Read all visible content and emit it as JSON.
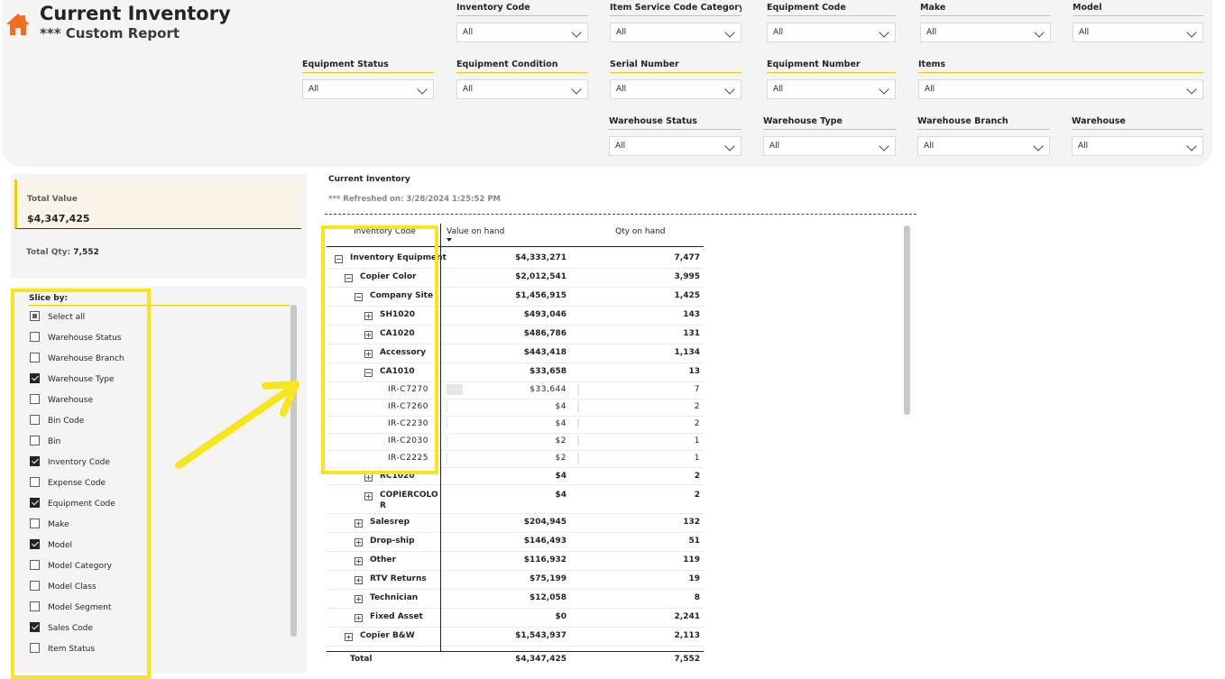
{
  "header": {
    "title": "Current Inventory",
    "subtitle": "*** Custom Report"
  },
  "filters": [
    {
      "label": "Inventory Code",
      "value": "All"
    },
    {
      "label": "Item Service Code Category",
      "value": "All"
    },
    {
      "label": "Equipment Code",
      "value": "All"
    },
    {
      "label": "Make",
      "value": "All"
    },
    {
      "label": "Model",
      "value": "All"
    },
    {
      "label": "Equipment Status",
      "value": "All"
    },
    {
      "label": "Equipment Condition",
      "value": "All"
    },
    {
      "label": "Serial Number",
      "value": "All"
    },
    {
      "label": "Equipment Number",
      "value": "All"
    },
    {
      "label": "Items",
      "value": "All"
    },
    {
      "label": "Warehouse Status",
      "value": "All"
    },
    {
      "label": "Warehouse Type",
      "value": "All"
    },
    {
      "label": "Warehouse Branch",
      "value": "All"
    },
    {
      "label": "Warehouse",
      "value": "All"
    }
  ],
  "kpi": {
    "total_value_label": "Total Value",
    "total_value": "$4,347,425",
    "total_qty_label": "Total Qty:",
    "total_qty": "7,552"
  },
  "slice_by": {
    "title": "Slice by:",
    "items": [
      {
        "label": "Select all",
        "state": "partial"
      },
      {
        "label": "Warehouse Status",
        "state": "unchecked"
      },
      {
        "label": "Warehouse Branch",
        "state": "unchecked"
      },
      {
        "label": "Warehouse Type",
        "state": "checked"
      },
      {
        "label": "Warehouse",
        "state": "unchecked"
      },
      {
        "label": "Bin Code",
        "state": "unchecked"
      },
      {
        "label": "Bin",
        "state": "unchecked"
      },
      {
        "label": "Inventory Code",
        "state": "checked"
      },
      {
        "label": "Expense Code",
        "state": "unchecked"
      },
      {
        "label": "Equipment Code",
        "state": "checked"
      },
      {
        "label": "Make",
        "state": "unchecked"
      },
      {
        "label": "Model",
        "state": "checked"
      },
      {
        "label": "Model Category",
        "state": "unchecked"
      },
      {
        "label": "Model Class",
        "state": "unchecked"
      },
      {
        "label": "Model Segment",
        "state": "unchecked"
      },
      {
        "label": "Sales Code",
        "state": "checked"
      },
      {
        "label": "Item Status",
        "state": "unchecked"
      }
    ]
  },
  "matrix": {
    "title": "Current Inventory",
    "refreshed": "*** Refreshed on: 3/28/2024 1:25:52 PM",
    "headers": {
      "row": "Inventory Code",
      "col1": "Value on hand",
      "col2": "Qty on hand"
    },
    "rows": [
      {
        "label": "Inventory Equipment",
        "level": 0,
        "toggle": "minus",
        "value": "$4,333,271",
        "qty": "7,477"
      },
      {
        "label": "Copier Color",
        "level": 1,
        "toggle": "minus",
        "value": "$2,012,541",
        "qty": "3,995"
      },
      {
        "label": "Company Site",
        "level": 2,
        "toggle": "minus",
        "value": "$1,456,915",
        "qty": "1,425"
      },
      {
        "label": "SH1020",
        "level": 3,
        "toggle": "plus",
        "value": "$493,046",
        "qty": "143"
      },
      {
        "label": "CA1020",
        "level": 3,
        "toggle": "plus",
        "value": "$486,786",
        "qty": "131"
      },
      {
        "label": "Accessory",
        "level": 3,
        "toggle": "plus",
        "value": "$443,418",
        "qty": "1,134"
      },
      {
        "label": "CA1010",
        "level": 3,
        "toggle": "minus",
        "value": "$33,658",
        "qty": "13"
      },
      {
        "label": "IR-C7270",
        "level": 4,
        "toggle": "",
        "value": "$33,644",
        "qty": "7"
      },
      {
        "label": "IR-C7260",
        "level": 4,
        "toggle": "",
        "value": "$4",
        "qty": "2"
      },
      {
        "label": "IR-C2230",
        "level": 4,
        "toggle": "",
        "value": "$4",
        "qty": "2"
      },
      {
        "label": "IR-C2030",
        "level": 4,
        "toggle": "",
        "value": "$2",
        "qty": "1"
      },
      {
        "label": "IR-C2225",
        "level": 4,
        "toggle": "",
        "value": "$2",
        "qty": "1"
      },
      {
        "label": "RC1020",
        "level": 3,
        "toggle": "plus",
        "value": "$4",
        "qty": "2"
      },
      {
        "label": "COPIERCOLO",
        "label2": "R",
        "level": 3,
        "toggle": "plus",
        "value": "$4",
        "qty": "2"
      },
      {
        "label": "Salesrep",
        "level": 2,
        "toggle": "plus",
        "value": "$204,945",
        "qty": "132"
      },
      {
        "label": "Drop-ship",
        "level": 2,
        "toggle": "plus",
        "value": "$146,493",
        "qty": "51"
      },
      {
        "label": "Other",
        "level": 2,
        "toggle": "plus",
        "value": "$116,932",
        "qty": "119"
      },
      {
        "label": "RTV Returns",
        "level": 2,
        "toggle": "plus",
        "value": "$75,199",
        "qty": "19"
      },
      {
        "label": "Technician",
        "level": 2,
        "toggle": "plus",
        "value": "$12,058",
        "qty": "8"
      },
      {
        "label": "Fixed Asset",
        "level": 2,
        "toggle": "plus",
        "value": "$0",
        "qty": "2,241"
      },
      {
        "label": "Copier B&W",
        "level": 1,
        "toggle": "plus",
        "value": "$1,543,937",
        "qty": "2,113"
      }
    ],
    "total": {
      "label": "Total",
      "value": "$4,347,425",
      "qty": "7,552"
    }
  },
  "colors": {
    "accent": "#f2c811",
    "highlight": "#f8e61c",
    "home": "#f26d21"
  }
}
